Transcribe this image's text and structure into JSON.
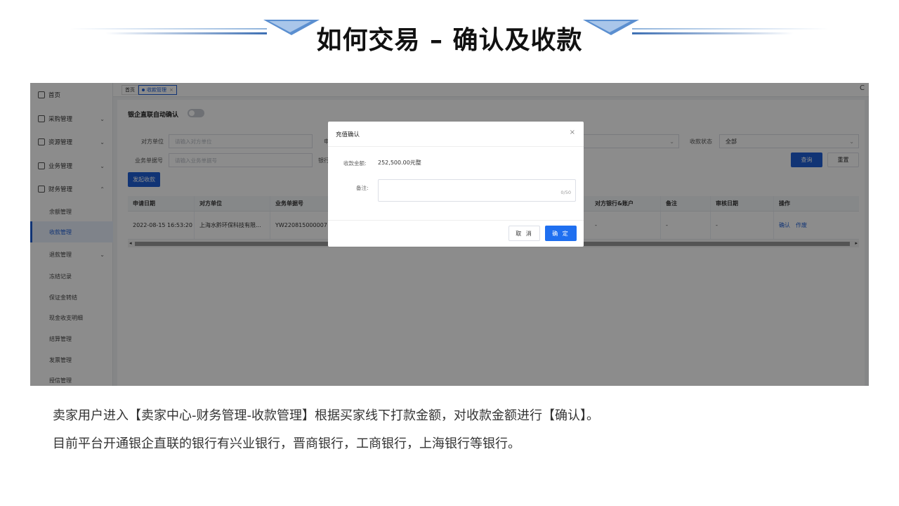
{
  "slide": {
    "title": "如何交易 – 确认及收款",
    "caption_line1": "卖家用户进入【卖家中心-财务管理-收款管理】根据买家线下打款金额，对收款金额进行【确认】。",
    "caption_line2": "目前平台开通银企直联的银行有兴业银行，晋商银行，工商银行，上海银行等银行。"
  },
  "sidebar": {
    "items": [
      {
        "label": "首页",
        "icon": "home-icon",
        "expandable": false
      },
      {
        "label": "采购管理",
        "icon": "truck-icon",
        "expandable": true
      },
      {
        "label": "资源管理",
        "icon": "box-icon",
        "expandable": true
      },
      {
        "label": "业务管理",
        "icon": "document-icon",
        "expandable": true
      },
      {
        "label": "财务管理",
        "icon": "wallet-icon",
        "expandable": true,
        "expanded": true
      }
    ],
    "sub_items": [
      {
        "label": "余额管理",
        "active": false
      },
      {
        "label": "收款管理",
        "active": true
      },
      {
        "label": "退款管理",
        "active": false,
        "expandable": true
      },
      {
        "label": "冻结记录",
        "active": false
      },
      {
        "label": "保证金转结",
        "active": false
      },
      {
        "label": "现金收支明细",
        "active": false
      },
      {
        "label": "结算管理",
        "active": false
      },
      {
        "label": "发票管理",
        "active": false
      },
      {
        "label": "授信管理",
        "active": false
      }
    ]
  },
  "tabs": {
    "home": "首页",
    "active": "收款管理",
    "active_close": "×"
  },
  "toolbar": {
    "auto_confirm_label": "银企直联自动确认",
    "refresh_glyph": "C"
  },
  "filters": {
    "counterparty_label": "对方单位",
    "counterparty_placeholder": "请输入对方单位",
    "business_no_label": "业务单据号",
    "business_no_placeholder": "请输入业务单据号",
    "partial_label_1": "申",
    "partial_label_2": "银行",
    "status_label": "收款状态",
    "status_value": "全部",
    "search_button": "查询",
    "reset_button": "重置",
    "initiate_button": "发起收款"
  },
  "table": {
    "columns": [
      "申请日期",
      "对方单位",
      "业务单据号",
      "对方银行&账户",
      "备注",
      "审核日期",
      "操作"
    ],
    "rows": [
      {
        "date": "2022-08-15 16:53:20",
        "counterparty": "上海水黔环保科技有限...",
        "business_no": "YW220815000007",
        "bank_account": "-",
        "remark": "-",
        "audit_date": "-",
        "actions": [
          "确认",
          "作废"
        ]
      }
    ]
  },
  "modal": {
    "title": "充值确认",
    "close_glyph": "×",
    "amount_label": "收款金额:",
    "amount_value": "252,500.00元整",
    "note_label": "备注:",
    "note_value": "",
    "note_counter": "0/50",
    "cancel_button": "取 消",
    "confirm_button": "确 定"
  },
  "colors": {
    "primary": "#1f5fd6",
    "confirm_button": "#1f6ff0",
    "overlay": "rgba(0,0,0,0.45)"
  }
}
